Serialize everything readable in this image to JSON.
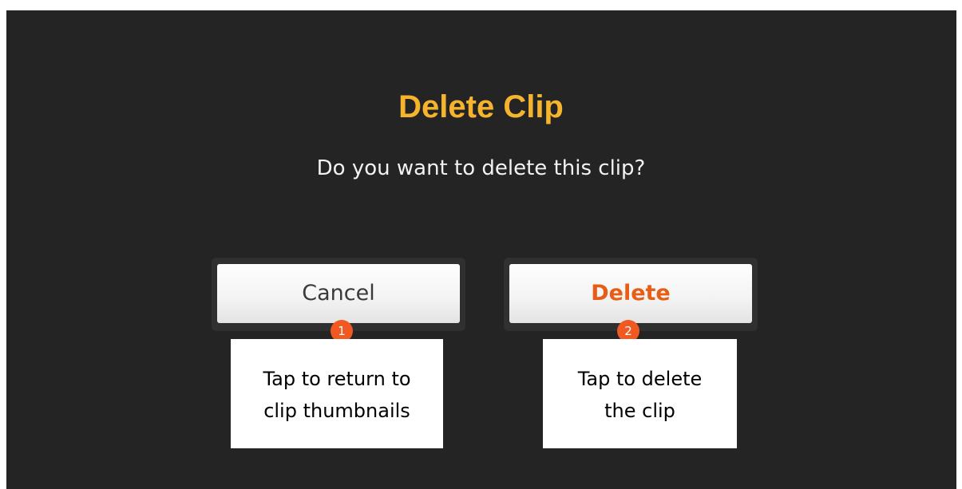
{
  "dialog": {
    "title": "Delete Clip",
    "message": "Do you want to delete this clip?",
    "cancel_label": "Cancel",
    "delete_label": "Delete"
  },
  "annotations": [
    {
      "number": "1",
      "lines": [
        "Tap to return to",
        "clip thumbnails"
      ]
    },
    {
      "number": "2",
      "lines": [
        "Tap to delete",
        "the clip"
      ]
    }
  ],
  "colors": {
    "background": "#242424",
    "title": "#f6b42e",
    "delete_text": "#e85d16",
    "badge": "#f05a22"
  }
}
